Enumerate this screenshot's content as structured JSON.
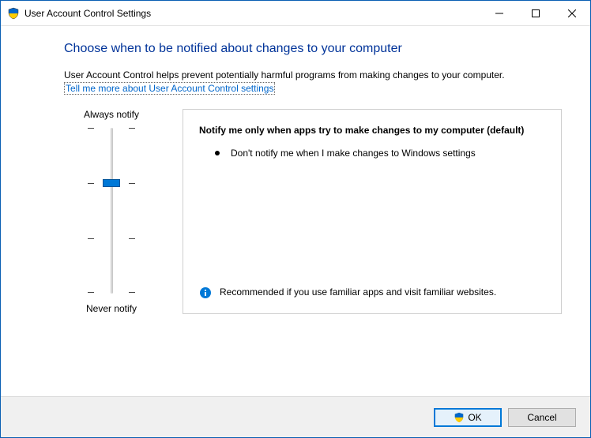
{
  "titlebar": {
    "title": "User Account Control Settings"
  },
  "content": {
    "heading": "Choose when to be notified about changes to your computer",
    "description": "User Account Control helps prevent potentially harmful programs from making changes to your computer.",
    "link": "Tell me more about User Account Control settings"
  },
  "slider": {
    "top_label": "Always notify",
    "bottom_label": "Never notify",
    "level": 1,
    "levels": 4
  },
  "panel": {
    "title": "Notify me only when apps try to make changes to my computer (default)",
    "bullet1": "Don't notify me when I make changes to Windows settings",
    "recommendation": "Recommended if you use familiar apps and visit familiar websites."
  },
  "buttons": {
    "ok": "OK",
    "cancel": "Cancel"
  }
}
